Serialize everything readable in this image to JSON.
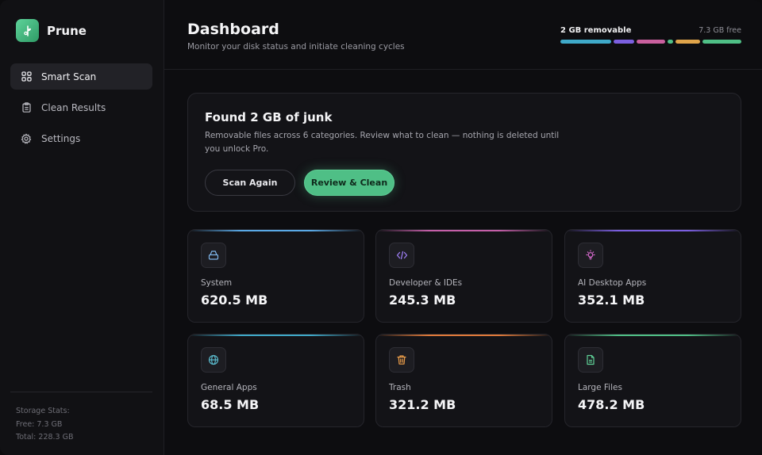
{
  "brand": {
    "name": "Prune",
    "accent": "#4fbf86"
  },
  "sidebar": {
    "items": [
      {
        "label": "Smart Scan",
        "icon": "grid-icon",
        "active": true
      },
      {
        "label": "Clean Results",
        "icon": "clipboard-icon",
        "active": false
      },
      {
        "label": "Settings",
        "icon": "gear-icon",
        "active": false
      }
    ],
    "storage": {
      "heading": "Storage Stats:",
      "free": "Free: 7.3 GB",
      "total": "Total: 228.3 GB"
    }
  },
  "header": {
    "title": "Dashboard",
    "subtitle": "Monitor your disk status and initiate cleaning cycles",
    "usage": {
      "removable": "2 GB removable",
      "free": "7.3 GB free",
      "segment_colors": [
        "#3fa9c9",
        "#7b5fe0",
        "#c95f9e",
        "#4fbf86",
        "#e0a44a",
        "#4fbf86"
      ]
    }
  },
  "hero": {
    "title": "Found 2 GB of junk",
    "description": "Removable files across 6 categories. Review what to clean — nothing is deleted until you unlock Pro.",
    "scan_again": "Scan Again",
    "review_clean": "Review & Clean"
  },
  "categories": [
    {
      "label": "System",
      "value": "620.5 MB",
      "icon": "drive-icon",
      "color": "#5aa9e6",
      "icon_color": "#7fb6ea"
    },
    {
      "label": "Developer & IDEs",
      "value": "245.3 MB",
      "icon": "code-icon",
      "color": "#c45fa8",
      "icon_color": "#9b7cf0"
    },
    {
      "label": "AI Desktop Apps",
      "value": "352.1 MB",
      "icon": "lightbulb-icon",
      "color": "#7b5fe0",
      "icon_color": "#d96bd0"
    },
    {
      "label": "General Apps",
      "value": "68.5 MB",
      "icon": "globe-icon",
      "color": "#3fa9c9",
      "icon_color": "#59b7c9"
    },
    {
      "label": "Trash",
      "value": "321.2 MB",
      "icon": "trash-icon",
      "color": "#e07a3a",
      "icon_color": "#f0a04a"
    },
    {
      "label": "Large Files",
      "value": "478.2 MB",
      "icon": "file-icon",
      "color": "#4fbf86",
      "icon_color": "#5fd197"
    }
  ]
}
